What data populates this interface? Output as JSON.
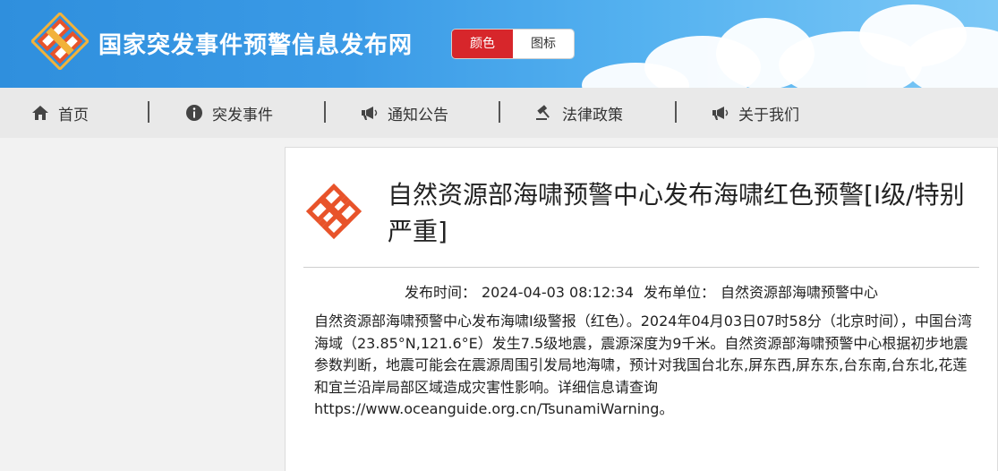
{
  "header": {
    "site_title": "国家突发事件预警信息发布网",
    "toggle": {
      "color_label": "颜色",
      "icon_label": "图标",
      "active": "color"
    }
  },
  "nav": {
    "items": [
      {
        "label": "首页",
        "icon": "home-icon"
      },
      {
        "label": "突发事件",
        "icon": "info-circle-icon"
      },
      {
        "label": "通知公告",
        "icon": "megaphone-icon"
      },
      {
        "label": "法律政策",
        "icon": "gavel-icon"
      },
      {
        "label": "关于我们",
        "icon": "megaphone-icon"
      }
    ]
  },
  "article": {
    "title": "自然资源部海啸预警中心发布海啸红色预警[Ⅰ级/特别严重]",
    "publish_time_label": "发布时间：",
    "publish_time": "2024-04-03 08:12:34",
    "publisher_label": "发布单位：",
    "publisher": "自然资源部海啸预警中心",
    "body": "自然资源部海啸预警中心发布海啸Ⅰ级警报（红色）。2024年04月03日07时58分（北京时间），中国台湾海域（23.85°N,121.6°E）发生7.5级地震，震源深度为9千米。自然资源部海啸预警中心根据初步地震参数判断，地震可能会在震源周围引发局地海啸，预计对我国台北东,屏东西,屏东东,台东南,台东北,花莲和宜兰沿岸局部区域造成灾害性影响。详细信息请查询https://www.oceanguide.org.cn/TsunamiWarning。"
  },
  "colors": {
    "header_blue": "#2f8fdd",
    "active_red": "#d7262b",
    "logo_orange": "#e8532a"
  }
}
